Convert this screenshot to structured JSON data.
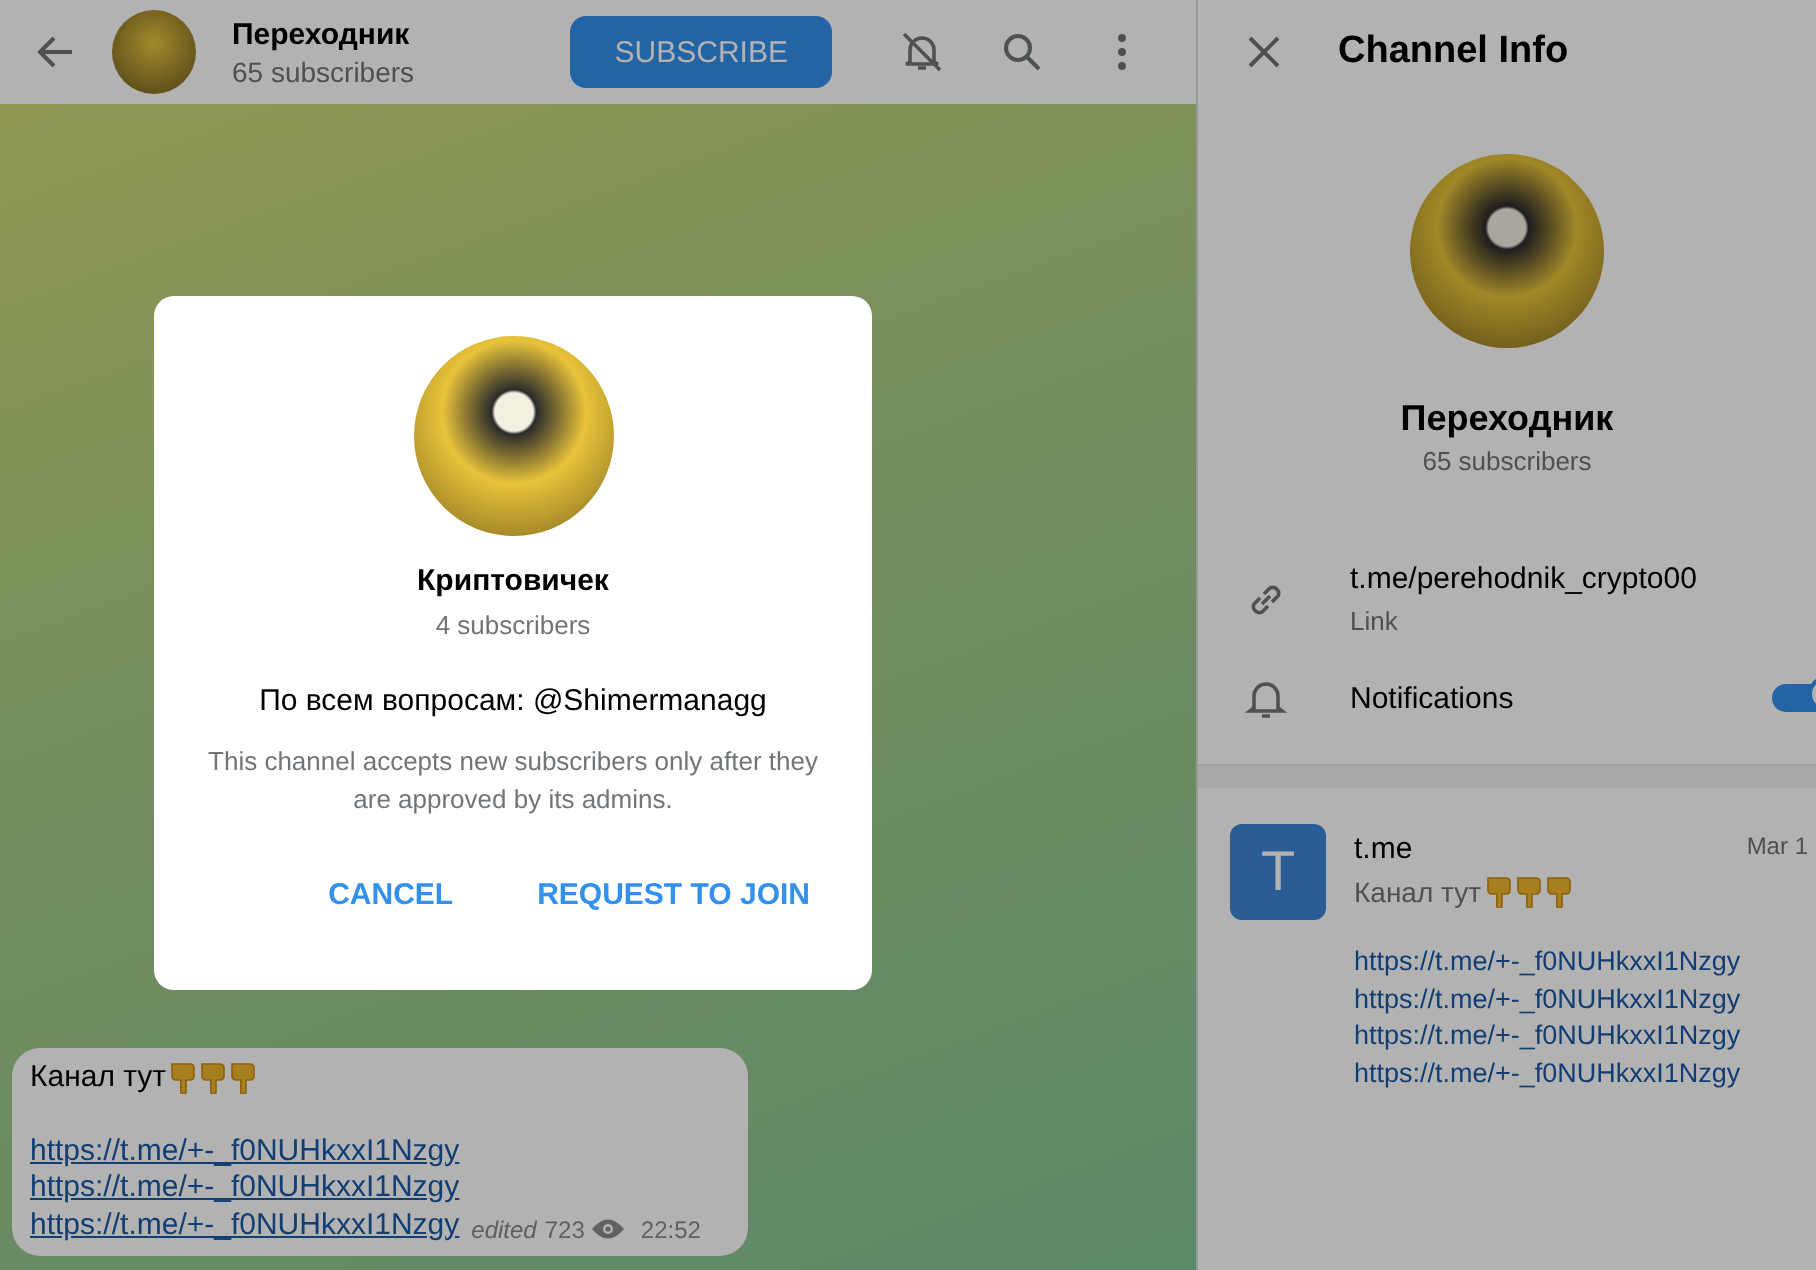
{
  "header": {
    "title": "Переходник",
    "subtitle": "65 subscribers",
    "subscribe_button": "SUBSCRIBE",
    "muted": true
  },
  "message": {
    "text": "Канал тут",
    "links": [
      "https://t.me/+-_f0NUHkxxI1Nzgy",
      "https://t.me/+-_f0NUHkxxI1Nzgy",
      "https://t.me/+-_f0NUHkxxI1Nzgy"
    ],
    "edited": "edited",
    "views": "723",
    "time": "22:52"
  },
  "dialog": {
    "name": "Криптовичек",
    "subscribers": "4 subscribers",
    "description": "По всем вопросам: @Shimermanagg",
    "notice": "This channel accepts new subscribers only after they are approved by its admins.",
    "buttons": [
      "CANCEL",
      "REQUEST TO JOIN"
    ]
  },
  "info_panel": {
    "title": "Channel Info",
    "name": "Переходник",
    "subscribers": "65 subscribers",
    "link": {
      "value": "t.me/perehodnik_crypto00",
      "label": "Link"
    },
    "notifications": {
      "label": "Notifications",
      "on": true
    },
    "post": {
      "avatar_letter": "T",
      "title": "t.me",
      "date": "Mar 1",
      "text": "Канал тут",
      "links": [
        "https://t.me/+-_f0NUHkxxI1Nzgy",
        "https://t.me/+-_f0NUHkxxI1Nzgy",
        "https://t.me/+-_f0NUHkxxI1Nzgy",
        "https://t.me/+-_f0NUHkxxI1Nzgy"
      ]
    }
  }
}
